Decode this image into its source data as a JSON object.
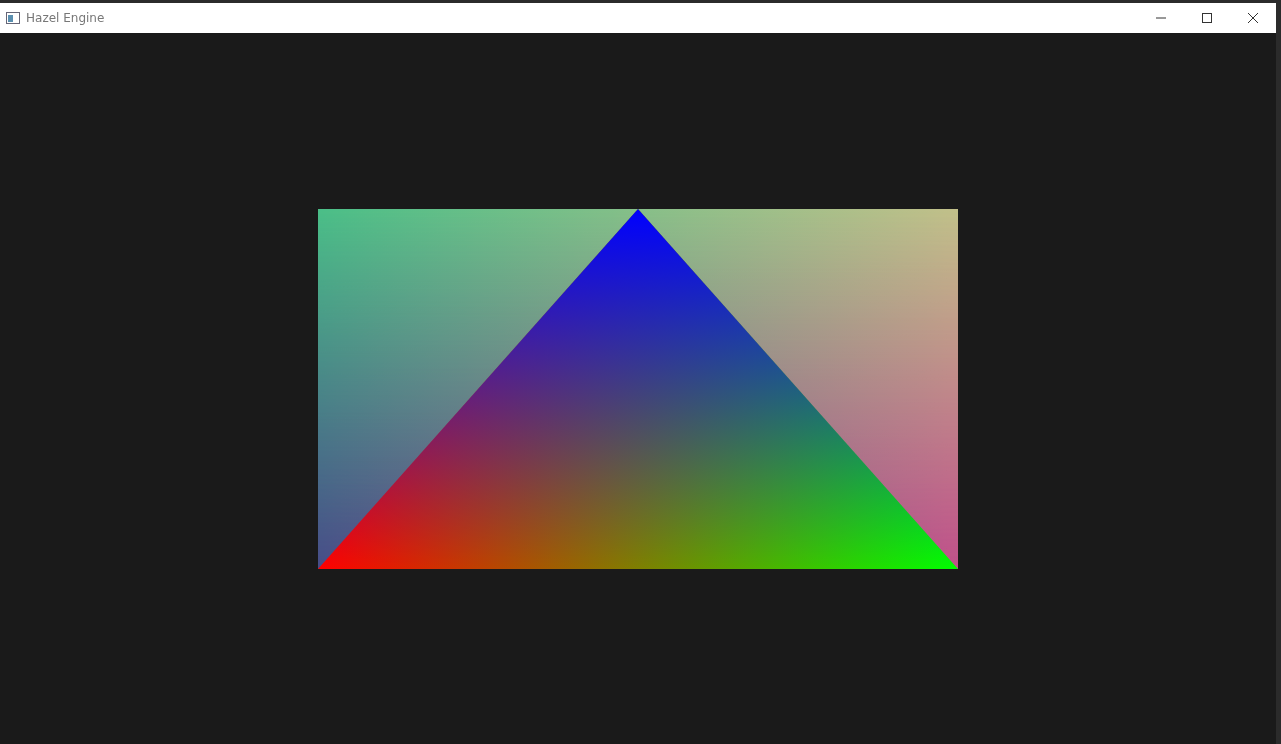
{
  "window": {
    "title": "Hazel Engine"
  }
}
